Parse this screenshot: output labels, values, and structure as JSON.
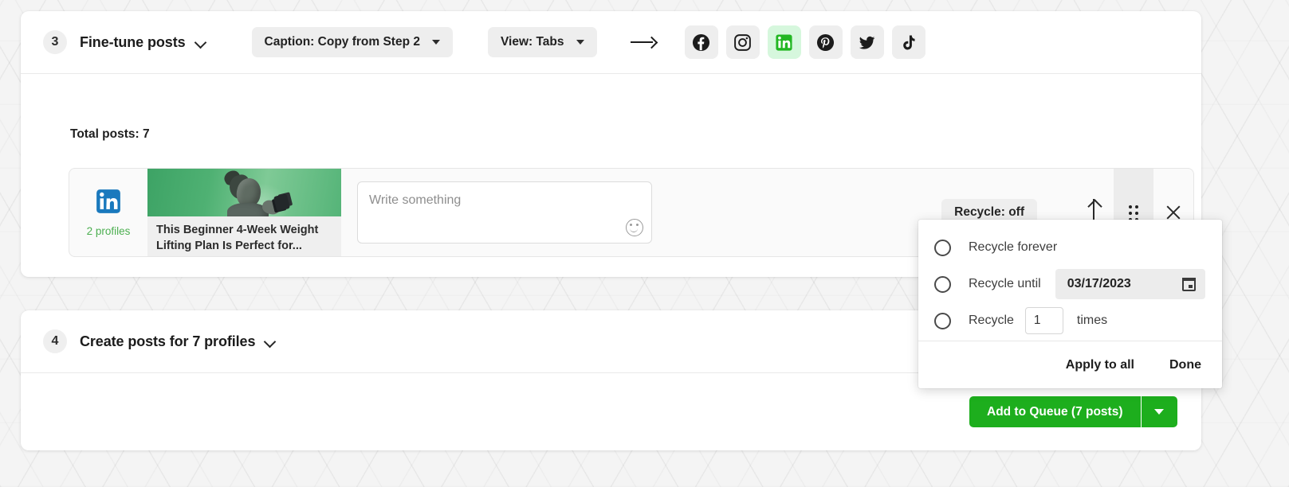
{
  "step3": {
    "number": "3",
    "title": "Fine-tune posts",
    "caption_pill": "Caption: Copy from Step 2",
    "view_pill": "View: Tabs",
    "networks": [
      {
        "name": "facebook",
        "label": "Facebook",
        "active": false
      },
      {
        "name": "instagram",
        "label": "Instagram",
        "active": false
      },
      {
        "name": "linkedin",
        "label": "LinkedIn",
        "active": true
      },
      {
        "name": "pinterest",
        "label": "Pinterest",
        "active": false
      },
      {
        "name": "twitter",
        "label": "Twitter",
        "active": false
      },
      {
        "name": "tiktok",
        "label": "TikTok",
        "active": false
      }
    ],
    "total_posts": "Total posts: 7",
    "post": {
      "network": "linkedin",
      "profiles_count": "2 profiles",
      "link_title": "This Beginner 4-Week Weight Lifting Plan Is Perfect for...",
      "editor_placeholder": "Write something",
      "recycle_pill": "Recycle: off"
    }
  },
  "recycle_panel": {
    "options": [
      {
        "label": "Recycle forever",
        "selected": false
      },
      {
        "label": "Recycle until",
        "selected": false
      },
      {
        "label": "Recycle",
        "selected": false
      }
    ],
    "until_date": "03/17/2023",
    "times_value": "1",
    "times_unit": "times",
    "apply_to_all": "Apply to all",
    "done": "Done"
  },
  "step4": {
    "number": "4",
    "title": "Create posts for 7 profiles"
  },
  "queue": {
    "label": "Add to Queue (7 posts)"
  },
  "colors": {
    "accent_green": "#1dae1d",
    "active_chip_bg": "#d6f7dd",
    "profiles_green": "#4caf50",
    "linkedin_blue": "#0a66c2"
  }
}
